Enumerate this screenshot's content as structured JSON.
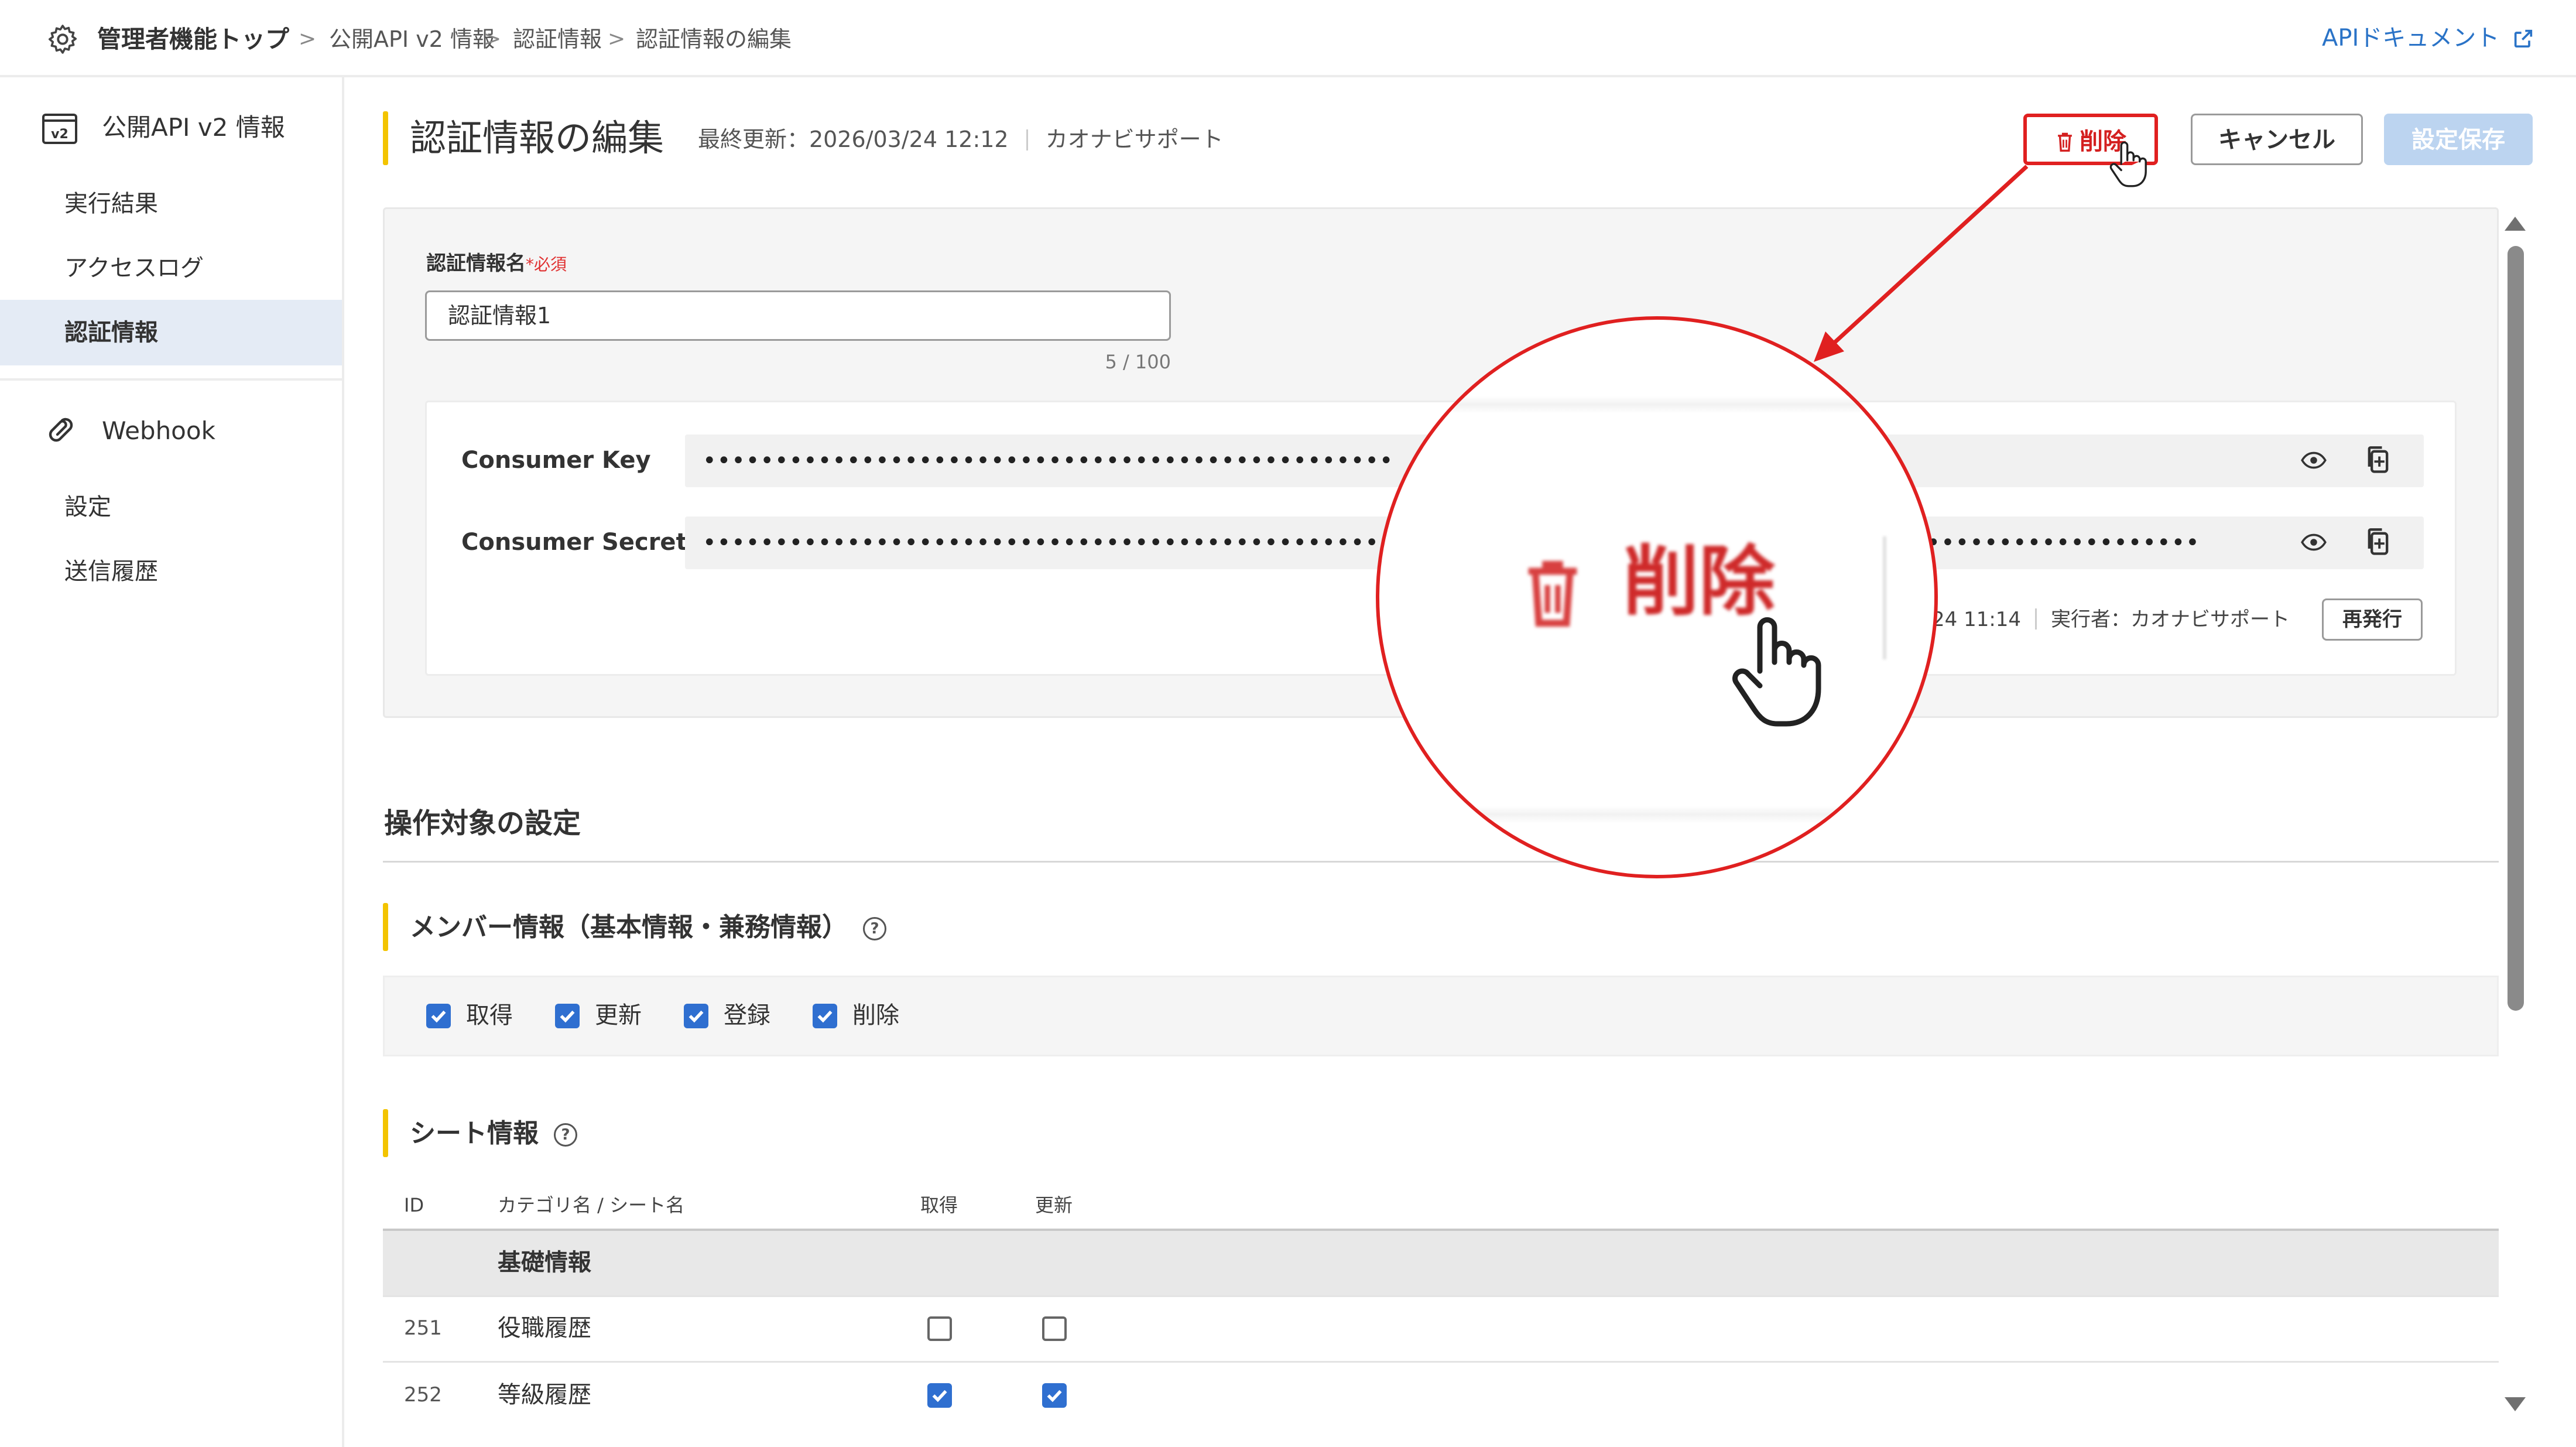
{
  "breadcrumb": {
    "home": "管理者機能トップ",
    "items": [
      "公開API v2 情報",
      "認証情報",
      "認証情報の編集"
    ],
    "separator": ">"
  },
  "header": {
    "doc_link": "APIドキュメント"
  },
  "sidebar": {
    "api_section": "公開API v2 情報",
    "api_items": [
      "実行結果",
      "アクセスログ",
      "認証情報"
    ],
    "active_item": "認証情報",
    "webhook_section": "Webhook",
    "webhook_items": [
      "設定",
      "送信履歴"
    ]
  },
  "page": {
    "title": "認証情報の編集",
    "last_updated": "最終更新：2026/03/24 12:12",
    "updated_by": "カオナビサポート"
  },
  "actions": {
    "delete": "削除",
    "cancel": "キャンセル",
    "save": "設定保存"
  },
  "credential": {
    "name_label": "認証情報名",
    "required": "*必須",
    "name_value": "認証情報1",
    "counter": "5 / 100",
    "consumer_key_label": "Consumer Key",
    "consumer_key_value": "••••••••••••••••••••••••••••••••••••••••••••••••",
    "consumer_secret_label": "Consumer Secret",
    "consumer_secret_value": "••••••••••••••••••••••••••••••••••••••••••••••••••••••••••••••••••••••••••••••••••••••••••••••••••••••••",
    "issued_time": "24 11:14",
    "issued_by": "実行者：カオナビサポート",
    "reissue": "再発行"
  },
  "targets": {
    "section_title": "操作対象の設定",
    "member_title": "メンバー情報（基本情報・兼務情報）",
    "member_perms": [
      {
        "label": "取得",
        "checked": true
      },
      {
        "label": "更新",
        "checked": true
      },
      {
        "label": "登録",
        "checked": true
      },
      {
        "label": "削除",
        "checked": true
      }
    ],
    "sheet_title": "シート情報",
    "help_glyph": "?",
    "table": {
      "headers": [
        "ID",
        "カテゴリ名 / シート名",
        "取得",
        "更新"
      ],
      "category": "基礎情報",
      "rows": [
        {
          "id": "251",
          "name": "役職履歴",
          "get": false,
          "update": false
        },
        {
          "id": "252",
          "name": "等級履歴",
          "get": true,
          "update": true
        }
      ]
    }
  },
  "zoom": {
    "label": "削除"
  },
  "icons": {
    "gear": "gear-icon",
    "external": "external-link-icon",
    "trash": "trash-icon",
    "eye": "eye-icon",
    "copy": "copy-icon",
    "v2": "v2-icon",
    "webhook": "webhook-link-icon",
    "hand": "hand-pointer-icon"
  },
  "colors": {
    "accent_yellow": "#f3c400",
    "link_blue": "#2a73c7",
    "check_blue": "#2f6fd0",
    "delete_red": "#e02020",
    "active_bg": "#e4ebf5"
  }
}
